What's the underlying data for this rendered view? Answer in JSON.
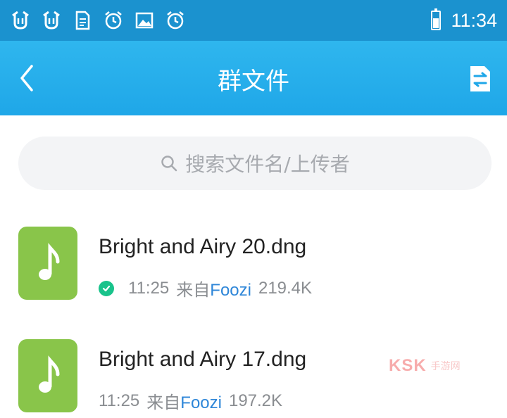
{
  "status_bar": {
    "time": "11:34",
    "icons": [
      "notification-icon",
      "notification-icon",
      "document-icon",
      "alarm-icon",
      "image-icon",
      "alarm-icon",
      "battery-icon"
    ]
  },
  "header": {
    "title": "群文件"
  },
  "search": {
    "placeholder": "搜索文件名/上传者"
  },
  "files": [
    {
      "name": "Bright and Airy 20.dng",
      "time": "11:25",
      "from_label": "来自",
      "uploader": "Foozi",
      "size": "219.4K",
      "downloaded": true
    },
    {
      "name": "Bright and Airy 17.dng",
      "time": "11:25",
      "from_label": "来自",
      "uploader": "Foozi",
      "size": "197.2K",
      "downloaded": false
    }
  ],
  "watermark": {
    "text": "KSK",
    "sub": "手游网"
  },
  "colors": {
    "status_bar": "#1b92cf",
    "title_bar": "#2fb6ee",
    "file_icon": "#89c54a",
    "uploader_link": "#2e86d8",
    "check": "#19c38b"
  }
}
